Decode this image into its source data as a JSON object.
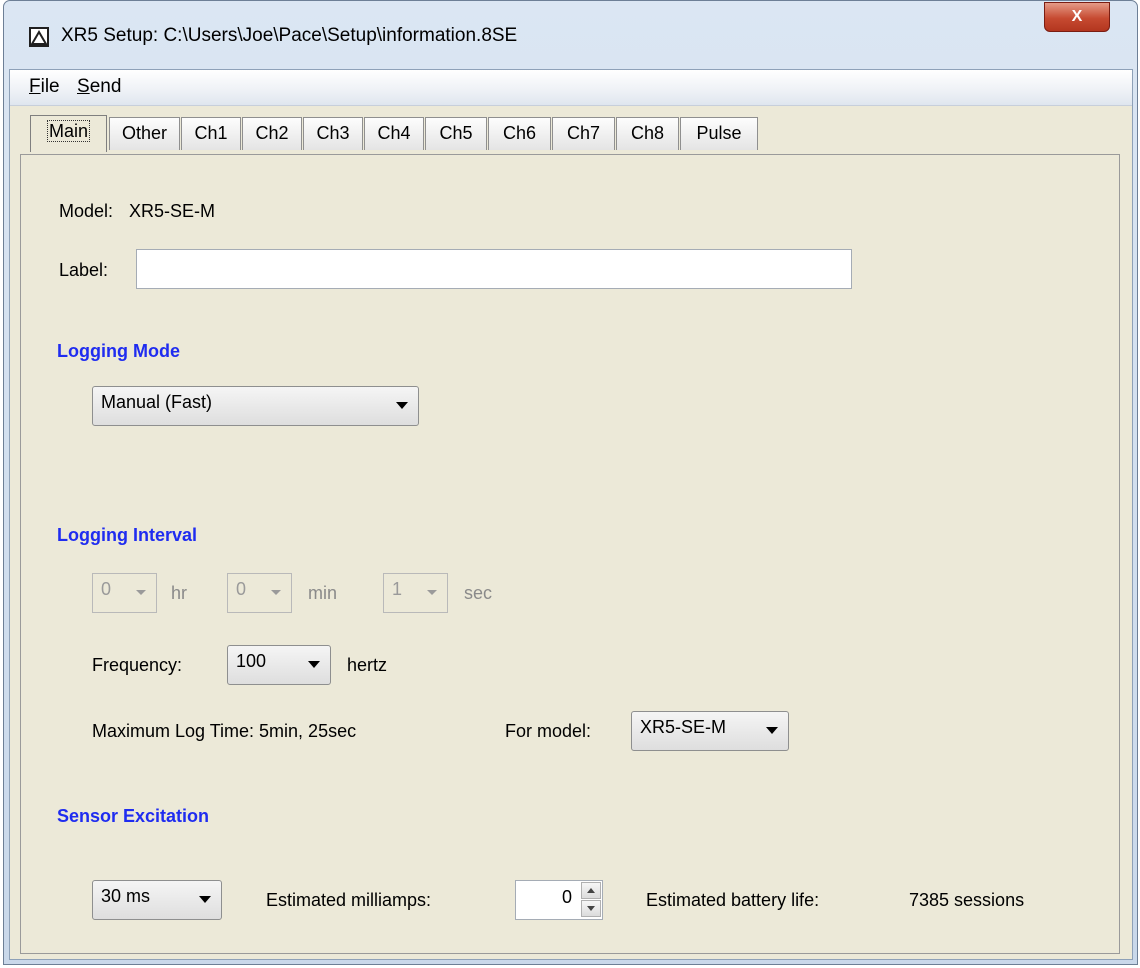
{
  "window": {
    "title": "XR5 Setup: C:\\Users\\Joe\\Pace\\Setup\\information.8SE",
    "close_label": "X"
  },
  "menu": {
    "file_mnemonic": "F",
    "file_rest": "ile",
    "send_mnemonic": "S",
    "send_rest": "end"
  },
  "tabs": [
    "Main",
    "Other",
    "Ch1",
    "Ch2",
    "Ch3",
    "Ch4",
    "Ch5",
    "Ch6",
    "Ch7",
    "Ch8",
    "Pulse"
  ],
  "main": {
    "model_label": "Model:",
    "model_value": "XR5-SE-M",
    "label_label": "Label:",
    "label_value": "",
    "logging_mode_heading": "Logging Mode",
    "logging_mode_value": "Manual (Fast)",
    "logging_interval_heading": "Logging Interval",
    "interval": {
      "hr_value": "0",
      "hr_unit": "hr",
      "min_value": "0",
      "min_unit": "min",
      "sec_value": "1",
      "sec_unit": "sec"
    },
    "frequency_label": "Frequency:",
    "frequency_value": "100",
    "frequency_unit": "hertz",
    "max_log_time": "Maximum Log Time: 5min, 25sec",
    "for_model_label": "For model:",
    "for_model_value": "XR5-SE-M",
    "sensor_excitation_heading": "Sensor Excitation",
    "excitation_value": "30 ms",
    "milliamps_label": "Estimated milliamps:",
    "milliamps_value": "0",
    "battery_life_label": "Estimated battery life:",
    "battery_life_value": "7385 sessions"
  },
  "colors": {
    "heading": "#1f2cf0",
    "panel_bg": "#ece9d8",
    "close_button": "#c64a31"
  }
}
